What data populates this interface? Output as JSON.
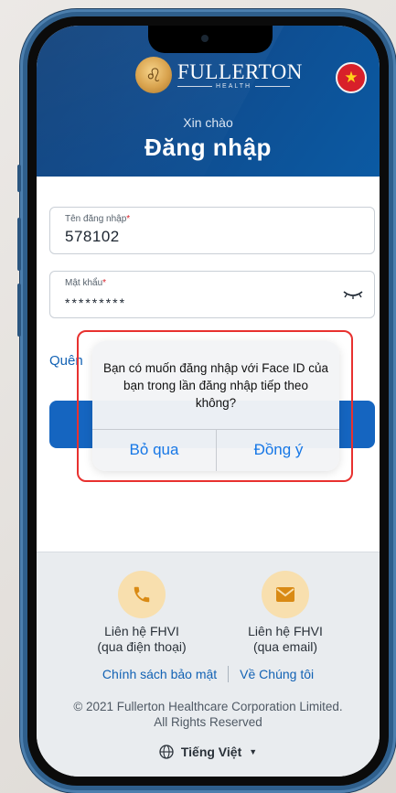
{
  "header": {
    "brand_name": "FULLERTON",
    "brand_sub": "HEALTH",
    "greeting": "Xin chào",
    "title": "Đăng nhập"
  },
  "form": {
    "username_label": "Tên đăng nhập",
    "username_value": "578102",
    "password_label": "Mật khẩu",
    "password_value": "*********",
    "required_mark": "*",
    "forgot_partial": "Quên"
  },
  "dialog": {
    "message": "Bạn có muốn đăng nhập với Face ID của bạn trong lần đăng nhập tiếp theo không?",
    "cancel_label": "Bỏ qua",
    "confirm_label": "Đồng ý"
  },
  "footer": {
    "contact_phone_line1": "Liên hệ FHVI",
    "contact_phone_line2": "(qua điện thoại)",
    "contact_email_line1": "Liên hệ FHVI",
    "contact_email_line2": "(qua email)",
    "privacy_link": "Chính sách bảo mật",
    "about_link": "Về Chúng tôi",
    "copyright_line1": "© 2021 Fullerton Healthcare Corporation Limited.",
    "copyright_line2": "All Rights Reserved",
    "language": "Tiếng Việt"
  },
  "colors": {
    "header_bg": "#0f4a8c",
    "primary_button": "#1565c0",
    "link": "#1262b4",
    "dialog_button": "#1677e6",
    "highlight": "#e8312f"
  }
}
